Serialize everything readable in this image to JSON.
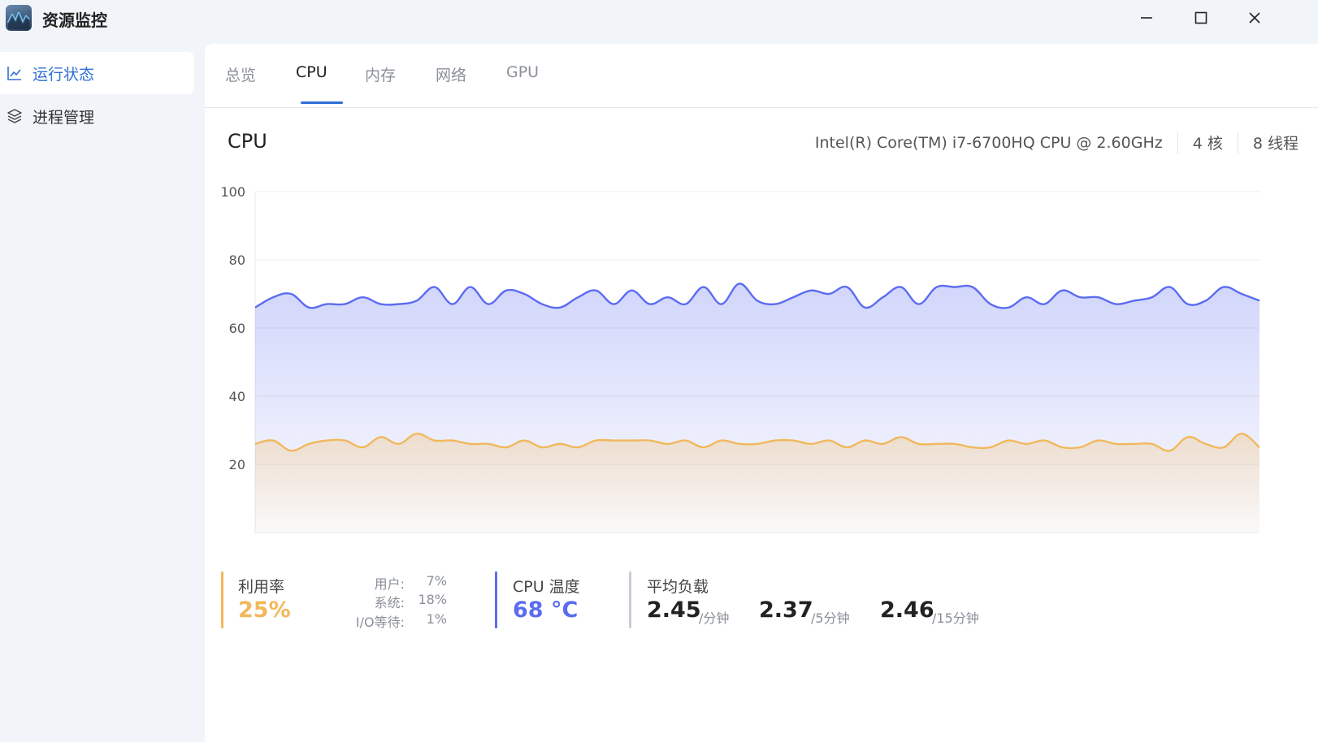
{
  "app": {
    "title": "资源监控"
  },
  "sidebar": {
    "items": [
      {
        "label": "运行状态",
        "icon": "line-chart-icon",
        "active": true
      },
      {
        "label": "进程管理",
        "icon": "layers-icon",
        "active": false
      }
    ]
  },
  "tabs": [
    {
      "label": "总览",
      "active": false
    },
    {
      "label": "CPU",
      "active": true
    },
    {
      "label": "内存",
      "active": false
    },
    {
      "label": "网络",
      "active": false
    },
    {
      "label": "GPU",
      "active": false
    }
  ],
  "cpu": {
    "title": "CPU",
    "model": "Intel(R) Core(TM) i7-6700HQ CPU @ 2.60GHz",
    "cores": "4 核",
    "threads": "8 线程"
  },
  "chart_data": {
    "type": "area",
    "ylim": [
      0,
      100
    ],
    "yticks": [
      "100",
      "80",
      "60",
      "40",
      "20"
    ],
    "grid": true,
    "series": [
      {
        "color": "#5b6cf0",
        "values": [
          66,
          69,
          70,
          66,
          67,
          67,
          69,
          67,
          67,
          68,
          72,
          67,
          72,
          67,
          71,
          70,
          67,
          66,
          69,
          71,
          67,
          71,
          67,
          69,
          67,
          72,
          67,
          73,
          68,
          67,
          69,
          71,
          70,
          72,
          66,
          69,
          72,
          67,
          72,
          72,
          72,
          67,
          66,
          69,
          67,
          71,
          69,
          69,
          67,
          68,
          69,
          72,
          67,
          68,
          72,
          70,
          68
        ]
      },
      {
        "color": "#f1b85c",
        "values": [
          26,
          27,
          24,
          26,
          27,
          27,
          25,
          28,
          26,
          29,
          27,
          27,
          26,
          26,
          25,
          27,
          25,
          26,
          25,
          27,
          27,
          27,
          27,
          26,
          27,
          25,
          27,
          26,
          26,
          27,
          27,
          26,
          27,
          25,
          27,
          26,
          28,
          26,
          26,
          26,
          25,
          25,
          27,
          26,
          27,
          25,
          25,
          27,
          26,
          26,
          26,
          24,
          28,
          26,
          25,
          29,
          25
        ]
      }
    ]
  },
  "stats": {
    "usage": {
      "label": "利用率",
      "value": "25%",
      "color": "#f1b85c",
      "breakdown": [
        {
          "label": "用户:",
          "value": "7%"
        },
        {
          "label": "系统:",
          "value": "18%"
        },
        {
          "label": "I/O等待:",
          "value": "1%"
        }
      ]
    },
    "temp": {
      "label": "CPU 温度",
      "value": "68 °C",
      "color": "#5b6cf0"
    },
    "load": {
      "label": "平均负载",
      "color": "#c8ccd4",
      "items": [
        {
          "value": "2.45",
          "unit": "/分钟"
        },
        {
          "value": "2.37",
          "unit": "/5分钟"
        },
        {
          "value": "2.46",
          "unit": "/15分钟"
        }
      ]
    }
  }
}
